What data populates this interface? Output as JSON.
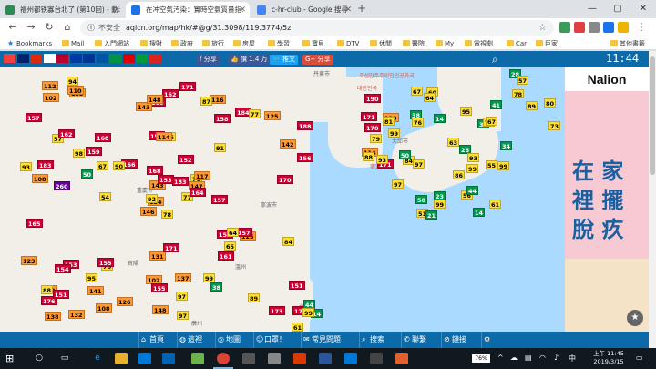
{
  "browser": {
    "tabs": [
      {
        "title": "福州都铁寡台北了 (第10回) - 動:",
        "favicon_color": "#2e8b57",
        "active": false
      },
      {
        "title": "在冲空氣汚染：實時空氣質量指:",
        "favicon_color": "#1a73e8",
        "active": true
      },
      {
        "title": "c-hr-club - Google 搜尋",
        "favicon_color": "#4285f4",
        "active": false
      }
    ],
    "address": {
      "security": "不安全",
      "url": "aqicn.org/map/hk/#@g/31.3098/119.3774/5z"
    },
    "bookmarks": [
      "Bookmarks",
      "Mail",
      "入門網站",
      "搜財",
      "政府",
      "旅行",
      "房屋",
      "學習",
      "寶貝",
      "DTV",
      "休閒",
      "醫院",
      "My",
      "電視劇",
      "Car",
      "臣家"
    ],
    "bookmarks_other": "其他書籤"
  },
  "site": {
    "share_fb": "分享",
    "like_fb": "讚 1.4 万",
    "tweet": "推文",
    "share_plus": "分享",
    "clock": "11:44",
    "flag_colors": [
      "#f04040",
      "#012169",
      "#de2910",
      "#ffffff",
      "#bc002d",
      "#0039a6",
      "#003399",
      "#0055a4",
      "#009246",
      "#dd0000",
      "#009c3b",
      "#da251d"
    ]
  },
  "map": {
    "labels": [
      {
        "text": "丹東市",
        "kind": "city"
      },
      {
        "text": "조선민주주의인민공화국",
        "kind": "sea"
      },
      {
        "text": "대한민국",
        "kind": "sea"
      },
      {
        "text": "寧波島",
        "kind": "sea"
      },
      {
        "text": "溫州",
        "kind": "city"
      },
      {
        "text": "寧波市",
        "kind": "city"
      },
      {
        "text": "大邱市",
        "kind": "city"
      },
      {
        "text": "重慶市",
        "kind": "city"
      },
      {
        "text": "貴陽",
        "kind": "city"
      },
      {
        "text": "廣州",
        "kind": "city"
      },
      {
        "text": "台灣",
        "kind": "city"
      }
    ],
    "stations_china": [
      78,
      57,
      134,
      102,
      70,
      76,
      116,
      85,
      158,
      77,
      133,
      170,
      260,
      188,
      146,
      91,
      132,
      151,
      152,
      153,
      166,
      176,
      141,
      114,
      117,
      125,
      162,
      160,
      108,
      153,
      156,
      92,
      102,
      143,
      168,
      184,
      155,
      173,
      151,
      157,
      171,
      90,
      50,
      161,
      108,
      93,
      147,
      138,
      155,
      164,
      154,
      142,
      157,
      65,
      38,
      95,
      110,
      112,
      137,
      125,
      162,
      54,
      183,
      159,
      77,
      94,
      87,
      143,
      153,
      123,
      131,
      126,
      64,
      67,
      88,
      102,
      98,
      165,
      168,
      97,
      183,
      151,
      157,
      84,
      148,
      170,
      171,
      89,
      97,
      99,
      148
    ],
    "stations_korea": [
      171,
      190,
      114,
      171,
      129,
      93,
      99,
      170,
      79,
      88
    ],
    "stations_japan": [
      99,
      56,
      37,
      14,
      38,
      51,
      63,
      61,
      34,
      26,
      81,
      67,
      97,
      55,
      60,
      84,
      74,
      44,
      76,
      97,
      86,
      95,
      99,
      21,
      99,
      93,
      64,
      14,
      23,
      67,
      50,
      41,
      50
    ],
    "stations_taiwan": [
      61,
      14,
      44,
      99
    ],
    "stations_far_east": [
      89,
      78,
      28,
      80,
      73,
      57
    ]
  },
  "ad": {
    "brand": "Nalion",
    "line1": "在 家",
    "line2": "裡 擺",
    "line3": "脫 疚"
  },
  "sitenav": [
    {
      "icon": "⌂",
      "label": "首頁"
    },
    {
      "icon": "◍",
      "label": "這裡"
    },
    {
      "icon": "◎",
      "label": "地圖"
    },
    {
      "icon": "☺",
      "label": "口罩！"
    },
    {
      "icon": "✉",
      "label": "常見問題"
    },
    {
      "icon": "⌕",
      "label": "搜索"
    },
    {
      "icon": "✆",
      "label": "聯繫"
    },
    {
      "icon": "⊘",
      "label": "鏈接"
    },
    {
      "icon": "⚙",
      "label": ""
    }
  ],
  "taskbar": {
    "battery": "76%",
    "time": "上午 11:45",
    "date": "2019/3/15"
  }
}
